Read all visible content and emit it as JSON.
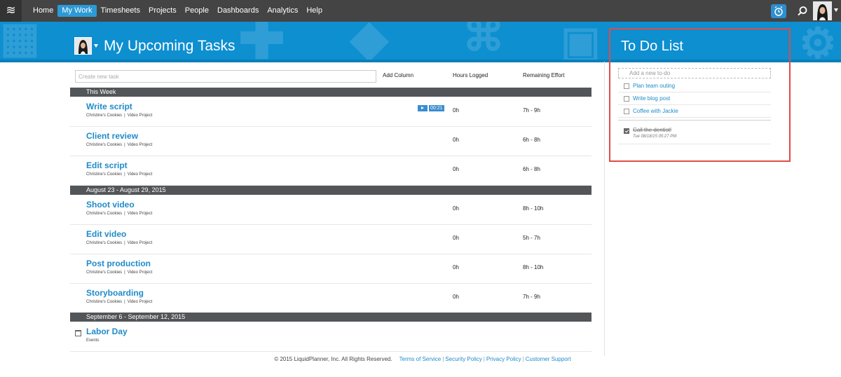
{
  "nav": {
    "logo": "≋",
    "items": [
      {
        "label": "Home",
        "active": false
      },
      {
        "label": "My Work",
        "active": true
      },
      {
        "label": "Timesheets",
        "active": false
      },
      {
        "label": "Projects",
        "active": false
      },
      {
        "label": "People",
        "active": false
      },
      {
        "label": "Dashboards",
        "active": false
      },
      {
        "label": "Analytics",
        "active": false
      },
      {
        "label": "Help",
        "active": false
      }
    ]
  },
  "header": {
    "title": "My Upcoming Tasks",
    "todo_title": "To Do List"
  },
  "tasks": {
    "create_placeholder": "Create new task",
    "columns": {
      "add_column": "Add Column",
      "hours_logged": "Hours Logged",
      "remaining_effort": "Remaining Effort"
    },
    "groups": [
      {
        "label": "This Week",
        "items": [
          {
            "name": "Write script",
            "client": "Christine's Cookies",
            "project": "Video Project",
            "hours": "0h",
            "effort": "7h - 9h",
            "timer": "00:21",
            "icon": ""
          },
          {
            "name": "Client review",
            "client": "Christine's Cookies",
            "project": "Video Project",
            "hours": "0h",
            "effort": "6h - 8h",
            "timer": "",
            "icon": ""
          },
          {
            "name": "Edit script",
            "client": "Christine's Cookies",
            "project": "Video Project",
            "hours": "0h",
            "effort": "6h - 8h",
            "timer": "",
            "icon": ""
          }
        ]
      },
      {
        "label": "August 23 - August 29, 2015",
        "items": [
          {
            "name": "Shoot video",
            "client": "Christine's Cookies",
            "project": "Video Project",
            "hours": "0h",
            "effort": "8h - 10h",
            "timer": "",
            "icon": ""
          },
          {
            "name": "Edit video",
            "client": "Christine's Cookies",
            "project": "Video Project",
            "hours": "0h",
            "effort": "5h - 7h",
            "timer": "",
            "icon": ""
          },
          {
            "name": "Post production",
            "client": "Christine's Cookies",
            "project": "Video Project",
            "hours": "0h",
            "effort": "8h - 10h",
            "timer": "",
            "icon": ""
          },
          {
            "name": "Storyboarding",
            "client": "Christine's Cookies",
            "project": "Video Project",
            "hours": "0h",
            "effort": "7h - 9h",
            "timer": "",
            "icon": ""
          }
        ]
      },
      {
        "label": "September 6 - September 12, 2015",
        "items": [
          {
            "name": "Labor Day",
            "client": "Events",
            "project": "",
            "hours": "",
            "effort": "",
            "timer": "",
            "icon": "calendar-icon"
          }
        ]
      }
    ]
  },
  "todo": {
    "add_placeholder": "Add a new to-do",
    "items": [
      {
        "label": "Plan team outing",
        "done": false
      },
      {
        "label": "Write blog post",
        "done": false
      },
      {
        "label": "Coffee with Jackie",
        "done": false
      }
    ],
    "done_items": [
      {
        "label": "Call the dentist!",
        "time": "Tue 08/18/15 05:27 PM",
        "done": true
      }
    ]
  },
  "footer": {
    "copyright": "© 2015 LiquidPlanner, Inc. All Rights Reserved.",
    "links": [
      "Terms of Service",
      "Security Policy",
      "Privacy Policy",
      "Customer Support"
    ]
  },
  "colors": {
    "nav_bg": "#444444",
    "banner_bg": "#0d8fd0",
    "accent": "#1f8bc9",
    "group_bar": "#525659",
    "highlight_frame": "#e04b47"
  }
}
